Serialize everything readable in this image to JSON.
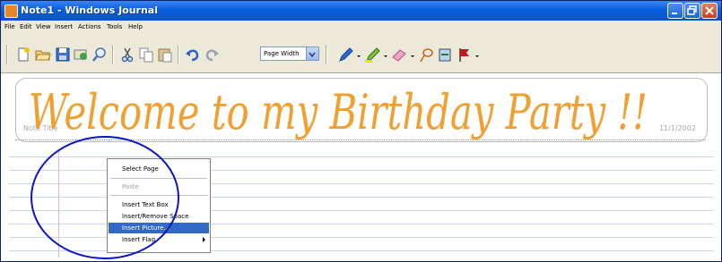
{
  "window": {
    "title": "Note1 - Windows Journal",
    "controls": [
      "minimize",
      "maximize",
      "close"
    ]
  },
  "menubar": {
    "items": [
      "File",
      "Edit",
      "View",
      "Insert",
      "Actions",
      "Tools",
      "Help"
    ]
  },
  "toolbar": {
    "icons": [
      "new-note-icon",
      "open-icon",
      "save-icon",
      "send-icon",
      "find-icon",
      "cut-icon",
      "copy-icon",
      "paste-icon",
      "undo-icon",
      "redo-icon",
      "pen-icon",
      "highlighter-icon",
      "eraser-icon",
      "lasso-icon",
      "insert-space-icon",
      "flag-icon"
    ],
    "zoom": {
      "value": "Page Width"
    }
  },
  "note": {
    "handwritten_title": "Welcome to my Birthday Party !!",
    "title_placeholder": "Note Title",
    "date": "11/1/2002",
    "ink_color": "#f0a030"
  },
  "context_menu": {
    "items": [
      {
        "label": "Select Page",
        "state": "normal"
      },
      {
        "label": "Paste",
        "state": "disabled"
      },
      {
        "label": "Insert Text Box",
        "state": "normal"
      },
      {
        "label": "Insert/Remove Space",
        "state": "normal"
      },
      {
        "label": "Insert Picture...",
        "state": "selected"
      },
      {
        "label": "Insert Flag",
        "state": "normal",
        "has_submenu": true
      }
    ]
  },
  "annotation": {
    "shape": "circle",
    "color": "#0a14c8"
  }
}
